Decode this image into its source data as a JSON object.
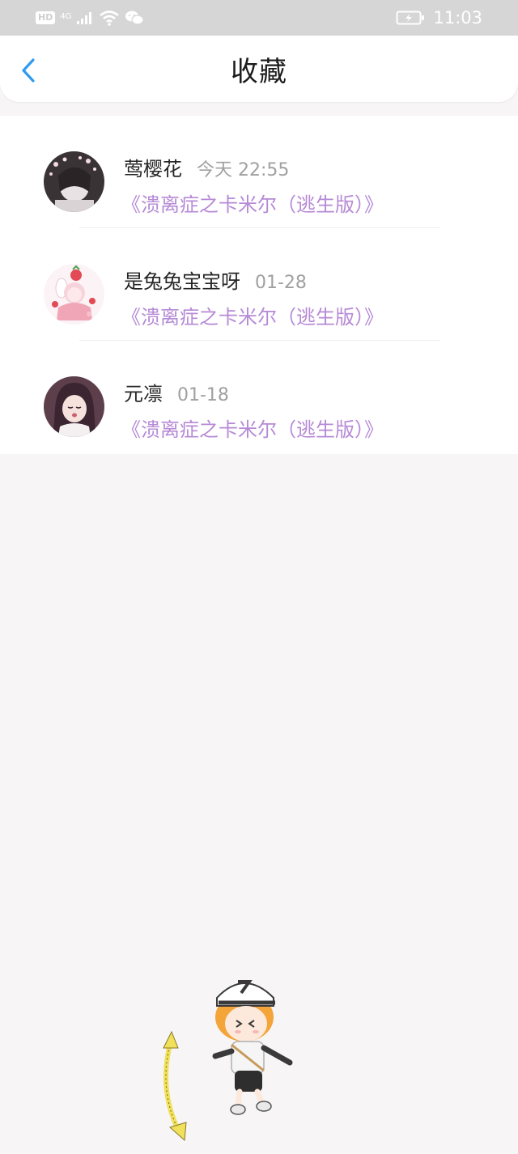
{
  "status_bar": {
    "hd": "HD",
    "network": "4G",
    "time": "11:03",
    "icons": [
      "hd-icon",
      "signal-icon",
      "wifi-icon",
      "wechat-icon",
      "battery-charging-icon"
    ]
  },
  "header": {
    "title": "收藏",
    "back_icon": "chevron-left-icon"
  },
  "favorites": [
    {
      "user": "莺樱花",
      "time": "今天 22:55",
      "title": "《溃离症之卡米尔（逃生版）》"
    },
    {
      "user": "是兔兔宝宝呀",
      "time": "01-28",
      "title": "《溃离症之卡米尔（逃生版）》"
    },
    {
      "user": "元凛",
      "time": "01-18",
      "title": "《溃离症之卡米尔（逃生版）》"
    }
  ],
  "colors": {
    "accent_blue": "#2f9bf0",
    "link_purple": "#b68ad6",
    "status_bar_bg": "#d6d6d6",
    "page_bg": "#f7f5f5"
  }
}
